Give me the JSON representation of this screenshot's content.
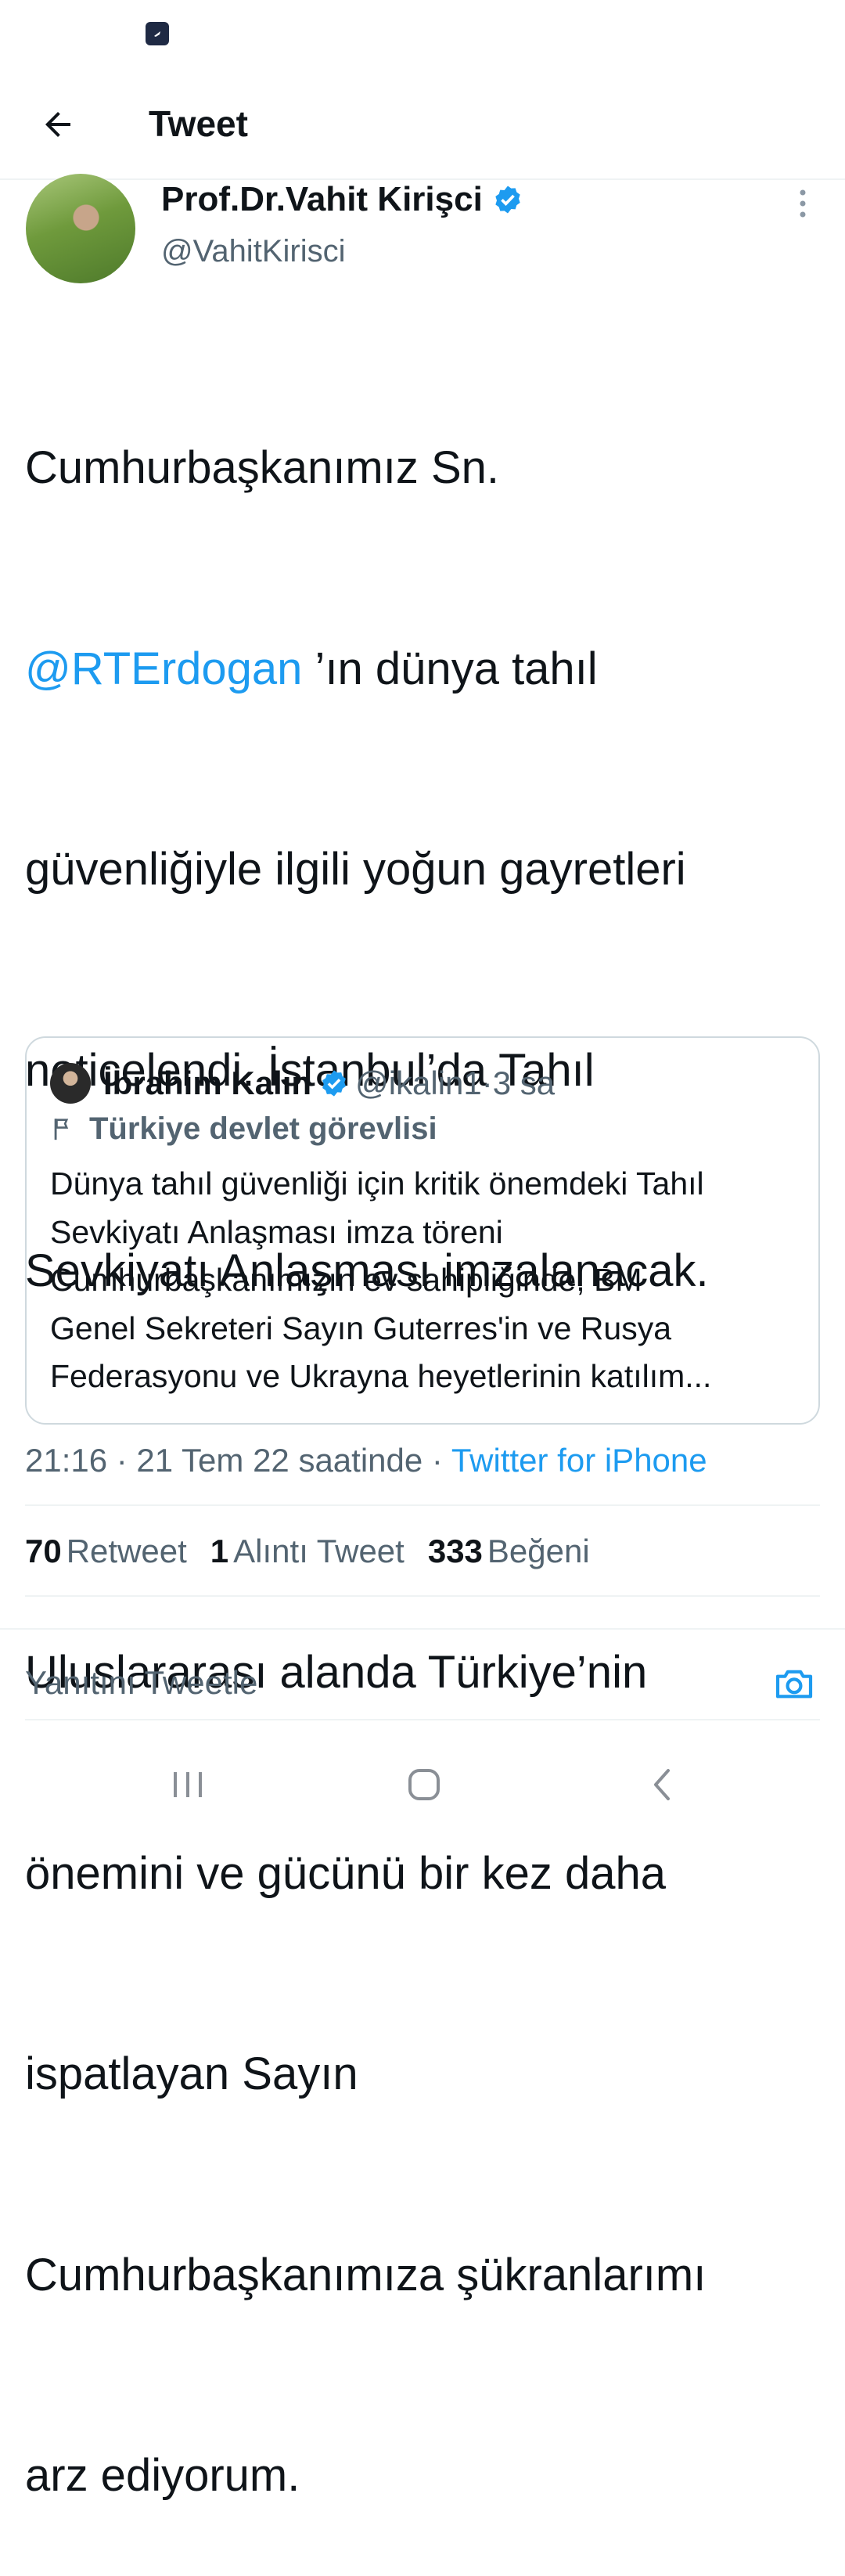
{
  "header": {
    "title": "Tweet"
  },
  "author": {
    "name": "Prof.Dr.Vahit Kirişci",
    "handle": "@VahitKirisci"
  },
  "tweet": {
    "line1": "Cumhurbaşkanımız Sn.",
    "mention": "@RTErdogan",
    "line2_rest": " ’ın dünya tahıl",
    "line3": "güvenliğiyle ilgili yoğun gayretleri",
    "line4": "neticelendi. İstanbul’da Tahıl",
    "line5": "Sevkiyatı Anlaşması imzalanacak.",
    "line6": "Uluslararası alanda Türkiye’nin",
    "line7": "önemini ve gücünü bir kez daha",
    "line8": "ispatlayan Sayın",
    "line9": "Cumhurbaşkanımıza şükranlarımı",
    "line10": "arz ediyorum."
  },
  "quote": {
    "name": "İbrahim Kalın",
    "handle": "@ikalin1",
    "dot": " · ",
    "time": "3 sa",
    "label": "Türkiye devlet görevlisi",
    "lines": [
      "Dünya tahıl güvenliği için kritik önemdeki Tahıl",
      "Sevkiyatı Anlaşması imza töreni",
      "Cumhurbaşkanımızın ev sahipliğinde, BM",
      "Genel Sekreteri Sayın Guterres'in ve Rusya",
      "Federasyonu ve Ukrayna heyetlerinin katılım..."
    ]
  },
  "meta": {
    "time": "21:16 · 21 Tem 22 saatinde · ",
    "source": "Twitter for iPhone"
  },
  "stats": {
    "retweets_count": "70",
    "retweets_label": "Retweet",
    "quotes_count": "1",
    "quotes_label": "Alıntı Tweet",
    "likes_count": "333",
    "likes_label": "Beğeni"
  },
  "reply": {
    "placeholder": "Yanıtını Tweetle"
  },
  "colors": {
    "accent": "#1d9bf0",
    "text": "#0f1419",
    "secondary": "#536471",
    "border": "#cfd9de"
  }
}
